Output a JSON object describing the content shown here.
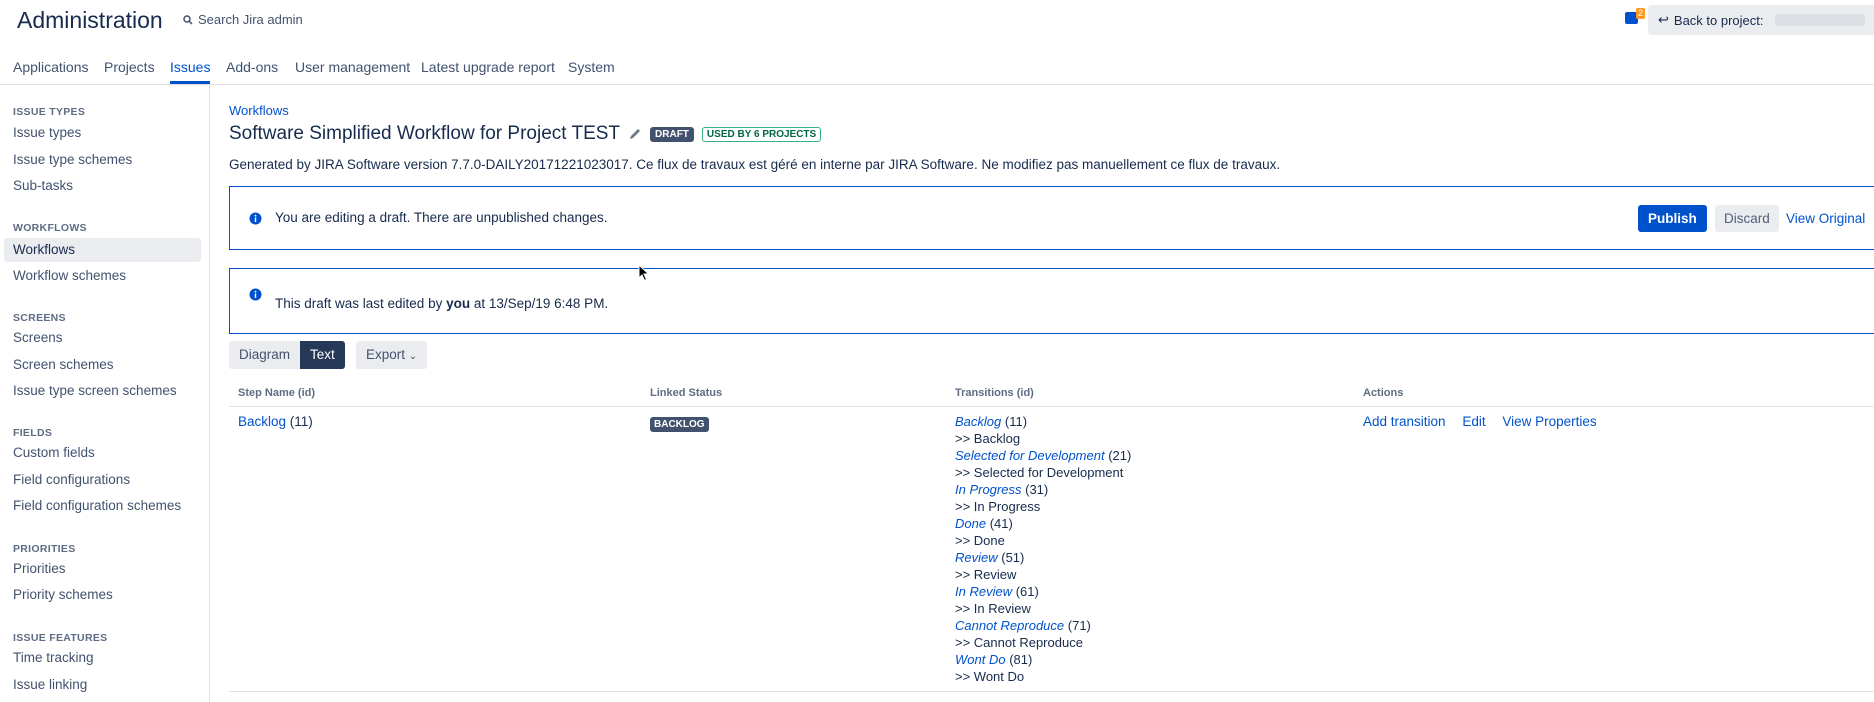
{
  "header": {
    "app_title": "Administration",
    "search_placeholder": "Search Jira admin",
    "notification_count": "2",
    "back_label": "Back to project:"
  },
  "topnav": {
    "tabs": [
      {
        "label": "Applications",
        "active": false
      },
      {
        "label": "Projects",
        "active": false
      },
      {
        "label": "Issues",
        "active": true
      },
      {
        "label": "Add-ons",
        "active": false
      },
      {
        "label": "User management",
        "active": false
      },
      {
        "label": "Latest upgrade report",
        "active": false
      },
      {
        "label": "System",
        "active": false
      }
    ]
  },
  "sidebar": {
    "sections": [
      {
        "heading": "ISSUE TYPES",
        "items": [
          "Issue types",
          "Issue type schemes",
          "Sub-tasks"
        ]
      },
      {
        "heading": "WORKFLOWS",
        "items": [
          "Workflows",
          "Workflow schemes"
        ]
      },
      {
        "heading": "SCREENS",
        "items": [
          "Screens",
          "Screen schemes",
          "Issue type screen schemes"
        ]
      },
      {
        "heading": "FIELDS",
        "items": [
          "Custom fields",
          "Field configurations",
          "Field configuration schemes"
        ]
      },
      {
        "heading": "PRIORITIES",
        "items": [
          "Priorities",
          "Priority schemes"
        ]
      },
      {
        "heading": "ISSUE FEATURES",
        "items": [
          "Time tracking",
          "Issue linking"
        ]
      }
    ],
    "active_item": "Workflows"
  },
  "main": {
    "breadcrumb": "Workflows",
    "title": "Software Simplified Workflow for Project TEST",
    "draft_lozenge": "DRAFT",
    "used_lozenge": "USED BY 6 PROJECTS",
    "description": "Generated by JIRA Software version 7.7.0-DAILY20171221023017. Ce flux de travaux est géré en interne par JIRA Software. Ne modifiez pas manuellement ce flux de travaux.",
    "draft_notice": "You are editing a draft. There are unpublished changes.",
    "publish_label": "Publish",
    "discard_label": "Discard",
    "view_original_label": "View Original",
    "last_edited_prefix": "This draft was last edited by ",
    "last_edited_user": "you",
    "last_edited_suffix": " at 13/Sep/19 6:48 PM.",
    "view_buttons": {
      "diagram": "Diagram",
      "text": "Text",
      "export": "Export"
    },
    "table": {
      "headers": {
        "step": "Step Name (id)",
        "status": "Linked Status",
        "transitions": "Transitions (id)",
        "actions": "Actions"
      },
      "rows": [
        {
          "step_name": "Backlog",
          "step_id": "(11)",
          "status": "BACKLOG",
          "transitions": [
            {
              "name": "Backlog",
              "id": "(11)",
              "target": ">> Backlog"
            },
            {
              "name": "Selected for Development",
              "id": "(21)",
              "target": ">> Selected for Development"
            },
            {
              "name": "In Progress",
              "id": "(31)",
              "target": ">> In Progress"
            },
            {
              "name": "Done",
              "id": "(41)",
              "target": ">> Done"
            },
            {
              "name": "Review",
              "id": "(51)",
              "target": ">> Review"
            },
            {
              "name": "In Review",
              "id": "(61)",
              "target": ">> In Review"
            },
            {
              "name": "Cannot Reproduce",
              "id": "(71)",
              "target": ">> Cannot Reproduce"
            },
            {
              "name": "Wont Do",
              "id": "(81)",
              "target": ">> Wont Do"
            }
          ],
          "actions": [
            "Add transition",
            "Edit",
            "View Properties"
          ]
        }
      ]
    }
  },
  "colors": {
    "accent": "#0052cc",
    "text": "#172b4d",
    "draft_lozenge": "#42526e",
    "used_lozenge_border": "#36b37e"
  }
}
